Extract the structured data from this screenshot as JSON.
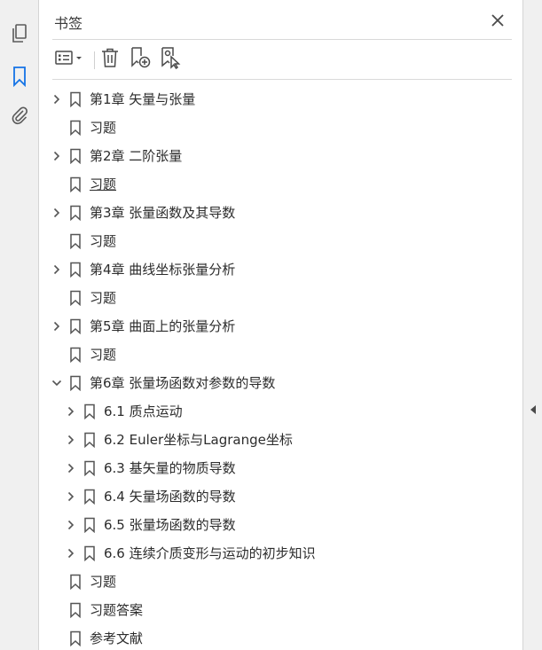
{
  "panel": {
    "title": "书签",
    "close_icon": "close-icon"
  },
  "rail": {
    "items": [
      {
        "icon": "pages-icon"
      },
      {
        "icon": "bookmark-icon",
        "active": true
      },
      {
        "icon": "attachment-icon"
      }
    ]
  },
  "toolbar": {
    "options_icon": "list-options-icon",
    "delete_icon": "trash-icon",
    "new_bookmark_icon": "add-bookmark-icon",
    "new_from_selection_icon": "bookmark-cursor-icon"
  },
  "colors": {
    "accent": "#1473e6",
    "text": "#2c2c2c",
    "rail_bg": "#f0f0f0",
    "divider": "#d9d9d9"
  },
  "bookmarks": [
    {
      "label": "第1章 矢量与张量",
      "level": 0,
      "expandable": true,
      "expanded": false
    },
    {
      "label": "习题",
      "level": 0,
      "expandable": false
    },
    {
      "label": "第2章 二阶张量",
      "level": 0,
      "expandable": true,
      "expanded": false
    },
    {
      "label": "习题",
      "level": 0,
      "expandable": false,
      "hovered": true
    },
    {
      "label": "第3章 张量函数及其导数",
      "level": 0,
      "expandable": true,
      "expanded": false
    },
    {
      "label": "习题",
      "level": 0,
      "expandable": false
    },
    {
      "label": "第4章 曲线坐标张量分析",
      "level": 0,
      "expandable": true,
      "expanded": false
    },
    {
      "label": "习题",
      "level": 0,
      "expandable": false
    },
    {
      "label": "第5章 曲面上的张量分析",
      "level": 0,
      "expandable": true,
      "expanded": false
    },
    {
      "label": "习题",
      "level": 0,
      "expandable": false
    },
    {
      "label": "第6章 张量场函数对参数的导数",
      "level": 0,
      "expandable": true,
      "expanded": true
    },
    {
      "label": "6.1 质点运动",
      "level": 1,
      "expandable": true,
      "expanded": false
    },
    {
      "label": "6.2 Euler坐标与Lagrange坐标",
      "level": 1,
      "expandable": true,
      "expanded": false
    },
    {
      "label": "6.3 基矢量的物质导数",
      "level": 1,
      "expandable": true,
      "expanded": false
    },
    {
      "label": "6.4 矢量场函数的导数",
      "level": 1,
      "expandable": true,
      "expanded": false
    },
    {
      "label": "6.5 张量场函数的导数",
      "level": 1,
      "expandable": true,
      "expanded": false
    },
    {
      "label": "6.6 连续介质变形与运动的初步知识",
      "level": 1,
      "expandable": true,
      "expanded": false
    },
    {
      "label": "习题",
      "level": 0,
      "expandable": false
    },
    {
      "label": "习题答案",
      "level": 0,
      "expandable": false
    },
    {
      "label": "参考文献",
      "level": 0,
      "expandable": false
    }
  ]
}
